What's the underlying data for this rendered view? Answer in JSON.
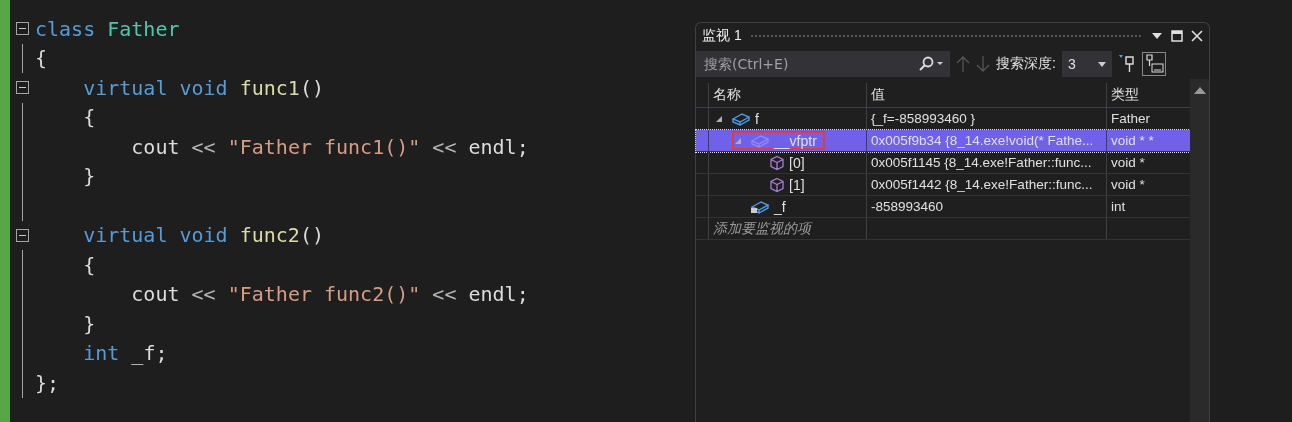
{
  "editor": {
    "lines": [
      {
        "fold_box": true,
        "tokens": [
          {
            "kind": "keyword",
            "text": "class "
          },
          {
            "kind": "type",
            "text": "Father"
          }
        ]
      },
      {
        "fold_box": false,
        "tokens": [
          {
            "kind": "punct",
            "text": "{"
          }
        ]
      },
      {
        "fold_box": true,
        "tokens": [
          {
            "kind": "keyword",
            "text": "    virtual void "
          },
          {
            "kind": "func",
            "text": "func1"
          },
          {
            "kind": "punct",
            "text": "()"
          }
        ]
      },
      {
        "fold_box": false,
        "tokens": [
          {
            "kind": "punct",
            "text": "    {"
          }
        ]
      },
      {
        "fold_box": false,
        "tokens": [
          {
            "kind": "plain",
            "text": "        cout "
          },
          {
            "kind": "op",
            "text": "<< "
          },
          {
            "kind": "string",
            "text": "\"Father func1()\""
          },
          {
            "kind": "op",
            "text": " <<"
          },
          {
            "kind": "plain",
            "text": " endl;"
          }
        ]
      },
      {
        "fold_box": false,
        "tokens": [
          {
            "kind": "punct",
            "text": "    }"
          }
        ]
      },
      {
        "fold_box": false
      },
      {
        "fold_box": true,
        "tokens": [
          {
            "kind": "keyword",
            "text": "    virtual void "
          },
          {
            "kind": "func",
            "text": "func2"
          },
          {
            "kind": "punct",
            "text": "()"
          }
        ]
      },
      {
        "fold_box": false,
        "tokens": [
          {
            "kind": "punct",
            "text": "    {"
          }
        ]
      },
      {
        "fold_box": false,
        "tokens": [
          {
            "kind": "plain",
            "text": "        cout "
          },
          {
            "kind": "op",
            "text": "<< "
          },
          {
            "kind": "string",
            "text": "\"Father func2()\""
          },
          {
            "kind": "op",
            "text": " <<"
          },
          {
            "kind": "plain",
            "text": " endl;"
          }
        ]
      },
      {
        "fold_box": false,
        "tokens": [
          {
            "kind": "punct",
            "text": "    }"
          }
        ]
      },
      {
        "fold_box": false,
        "tokens": [
          {
            "kind": "keyword",
            "text": "    int"
          },
          {
            "kind": "plain",
            "text": " _f;"
          }
        ]
      },
      {
        "fold_box": false,
        "tokens": [
          {
            "kind": "punct",
            "text": "};"
          }
        ]
      }
    ]
  },
  "watch": {
    "title": "监视 1",
    "search": {
      "placeholder": "搜索(Ctrl+E)"
    },
    "depth_label": "搜索深度:",
    "depth_value": "3",
    "columns": [
      "名称",
      "值",
      "类型"
    ],
    "rows": [
      {
        "kind": "object",
        "name": "f",
        "value": "{_f=-858993460 }",
        "type": "Father",
        "expanded": true,
        "selected": false,
        "highlighted": false,
        "children": [
          {
            "kind": "pointer",
            "name": "__vfptr",
            "value": "0x005f9b34 {8_14.exe!void(* Fathe...",
            "type": "void * *",
            "expanded": true,
            "selected": true,
            "highlighted": true,
            "children": [
              {
                "kind": "element",
                "name": "[0]",
                "value": "0x005f1145 {8_14.exe!Father::func...",
                "type": "void *",
                "selected": false,
                "highlighted": false
              },
              {
                "kind": "element",
                "name": "[1]",
                "value": "0x005f1442 {8_14.exe!Father::func...",
                "type": "void *",
                "selected": false,
                "highlighted": false
              }
            ]
          },
          {
            "kind": "private_field",
            "name": "_f",
            "value": "-858993460",
            "type": "int",
            "selected": false,
            "highlighted": false
          }
        ]
      }
    ],
    "add_placeholder": "添加要监视的项"
  }
}
